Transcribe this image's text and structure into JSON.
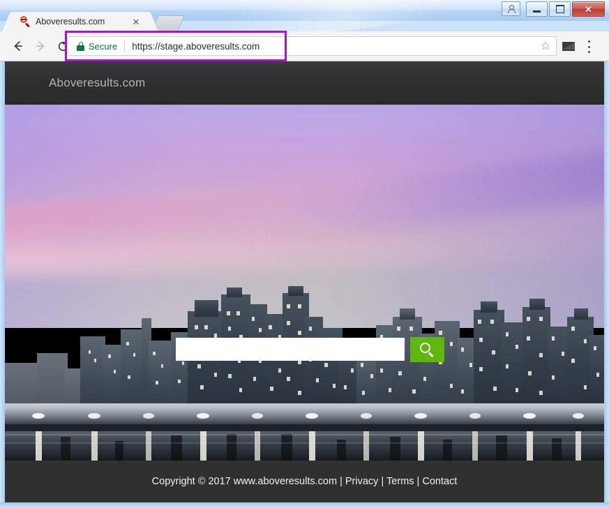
{
  "window": {
    "caption_buttons": {
      "user_icon": "user-account-icon",
      "minimize": "–",
      "maximize": "□",
      "close": "✕"
    }
  },
  "browser": {
    "tab": {
      "favicon": "magnifier-favicon",
      "title": "Aboveresults.com",
      "close_label": "✕"
    },
    "new_tab_label": "",
    "nav": {
      "back_label": "←",
      "forward_label": "→",
      "reload_label": "↻"
    },
    "omnibox": {
      "security_icon": "lock-icon",
      "security_label": "Secure",
      "url": "https://stage.aboveresults.com",
      "bookmark_icon": "☆"
    },
    "toolbar_icons": {
      "cast": "cast-screen-icon",
      "menu": "three-dot-menu-icon"
    },
    "highlight_color": "#a716c9"
  },
  "page": {
    "header": {
      "brand": "Aboveresults.com"
    },
    "search": {
      "value": "",
      "placeholder": "",
      "button_icon": "search-icon",
      "button_color": "#5fb60f"
    },
    "hero": {
      "description": "night cityscape with purple-pink sunset sky and water reflections"
    },
    "footer": {
      "copyright": "Copyright © 2017 www.aboveresults.com",
      "separator": "|",
      "links": [
        {
          "label": "Privacy"
        },
        {
          "label": "Terms"
        },
        {
          "label": "Contact"
        }
      ]
    }
  }
}
